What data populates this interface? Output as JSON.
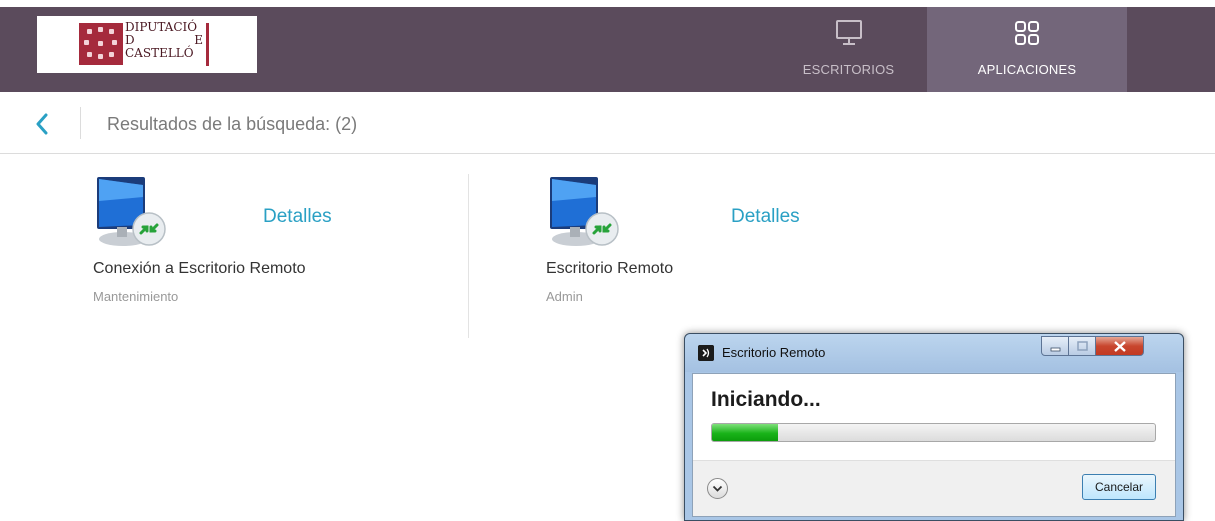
{
  "header": {
    "logo": {
      "line1": "DIPUTACIÓ",
      "line2_left": "D",
      "line2_right": "E",
      "line3": "CASTELLÓ"
    },
    "tabs": [
      {
        "label": "ESCRITORIOS",
        "icon": "monitor-icon",
        "active": false
      },
      {
        "label": "APLICACIONES",
        "icon": "apps-grid-icon",
        "active": true
      }
    ],
    "colors": {
      "bar": "#5b4b5c",
      "active_tab": "#73667a",
      "brand": "#a52a3c"
    }
  },
  "search": {
    "back_icon": "chevron-left-icon",
    "results_label": "Resultados de la búsqueda: (2)"
  },
  "apps": [
    {
      "name": "Conexión a Escritorio Remoto",
      "group": "Mantenimiento",
      "details_label": "Detalles",
      "icon": "remote-desktop-icon"
    },
    {
      "name": "Escritorio Remoto",
      "group": "Admin",
      "details_label": "Detalles",
      "icon": "remote-desktop-icon"
    }
  ],
  "dialog": {
    "title": "Escritorio Remoto",
    "heading": "Iniciando...",
    "progress_percent": 15,
    "cancel_label": "Cancelar",
    "icons": [
      "remote-desktop-app-icon",
      "minimize-icon",
      "maximize-icon",
      "close-icon",
      "expand-chevron-icon"
    ],
    "accent": "#19b319"
  }
}
